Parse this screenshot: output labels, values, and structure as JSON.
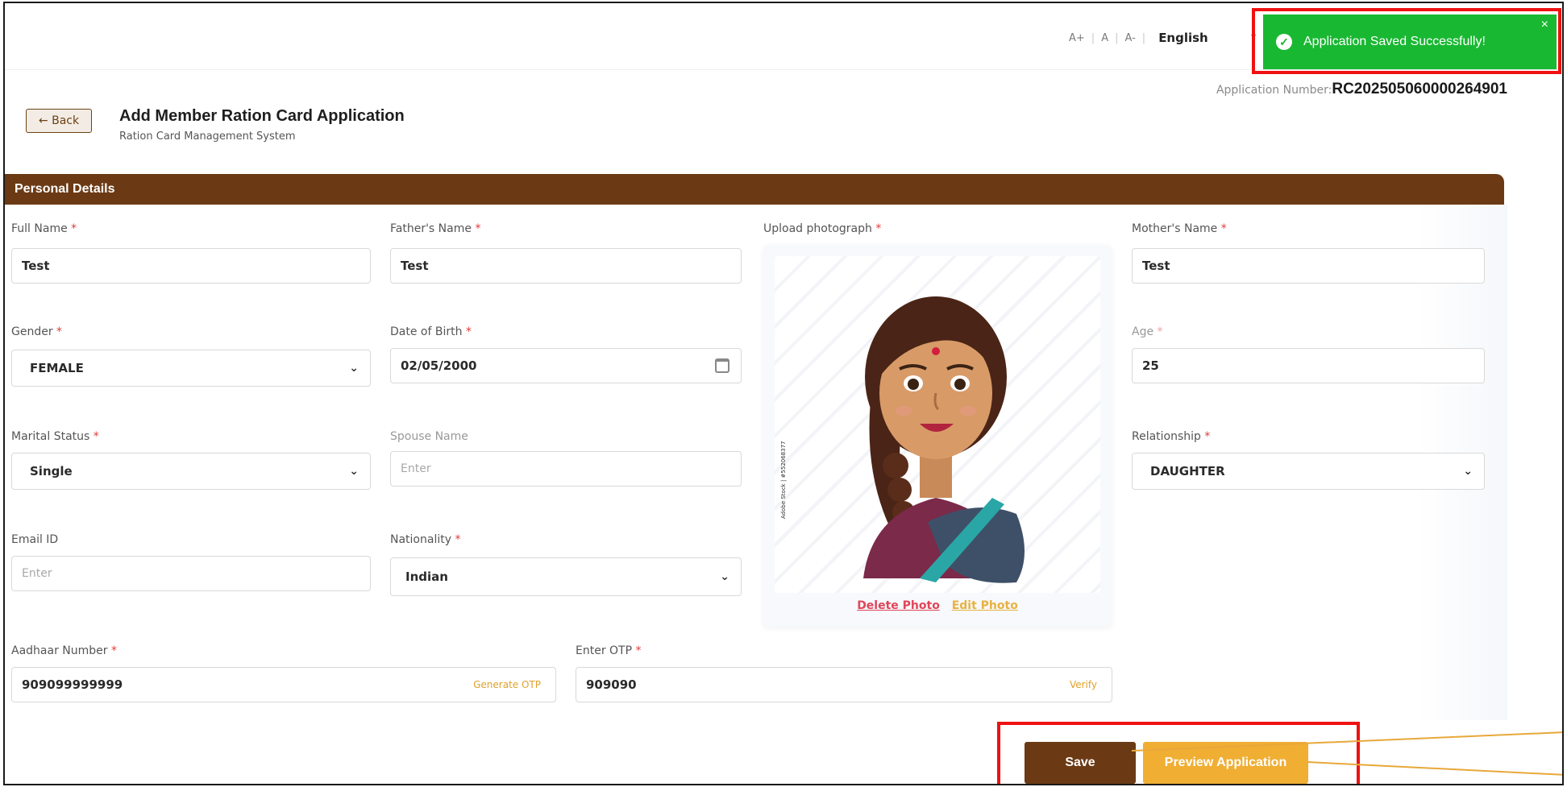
{
  "utility": {
    "font_increase": "A+",
    "font_normal": "A",
    "font_decrease": "A-",
    "language": "English"
  },
  "toast": {
    "message": "Application Saved Successfully!",
    "close": "×"
  },
  "application": {
    "number_label": "Application Number:",
    "number_value": "RC202505060000264901"
  },
  "header": {
    "back_label": "← Back",
    "title": "Add Member Ration Card Application",
    "subtitle": "Ration Card Management System"
  },
  "section": {
    "title": "Personal Details"
  },
  "form": {
    "full_name": {
      "label": "Full Name",
      "value": "Test"
    },
    "father_name": {
      "label": "Father's Name",
      "value": "Test"
    },
    "photo": {
      "label": "Upload photograph",
      "delete": "Delete Photo",
      "edit": "Edit Photo",
      "stock_text": "Adobe Stock | #552068377"
    },
    "mother_name": {
      "label": "Mother's Name",
      "value": "Test"
    },
    "gender": {
      "label": "Gender",
      "value": "FEMALE"
    },
    "dob": {
      "label": "Date of Birth",
      "value": "02/05/2000"
    },
    "age": {
      "label": "Age",
      "value": "25"
    },
    "marital_status": {
      "label": "Marital Status",
      "value": "Single"
    },
    "spouse_name": {
      "label": "Spouse Name",
      "placeholder": "Enter"
    },
    "relationship": {
      "label": "Relationship",
      "value": "DAUGHTER"
    },
    "email": {
      "label": "Email ID",
      "placeholder": "Enter"
    },
    "nationality": {
      "label": "Nationality",
      "value": "Indian"
    },
    "aadhaar": {
      "label": "Aadhaar Number",
      "value": "909099999999",
      "action": "Generate OTP"
    },
    "otp": {
      "label": "Enter OTP",
      "value": "909090",
      "action": "Verify"
    },
    "required_mark": "*"
  },
  "footer": {
    "save_label": "Save",
    "preview_label": "Preview Application"
  },
  "colors": {
    "brand_brown": "#6b3a14",
    "accent_orange": "#f0ae33",
    "success_green": "#19b832",
    "highlight_red": "#ef1111"
  }
}
